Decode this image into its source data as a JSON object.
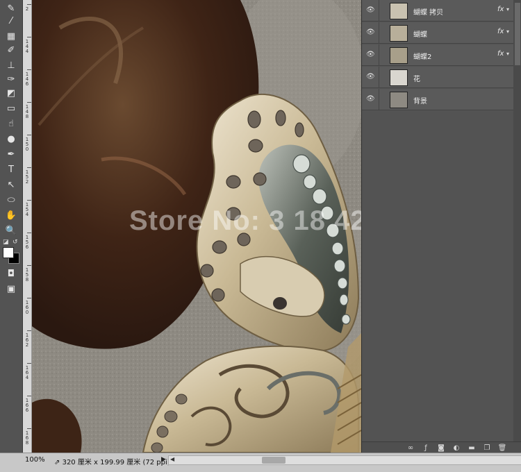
{
  "tools": [
    {
      "icon": "brush-icon",
      "glyph": "✎"
    },
    {
      "icon": "eyedropper-icon",
      "glyph": "⁄"
    },
    {
      "icon": "marquee-grid-icon",
      "glyph": "▦"
    },
    {
      "icon": "brush-tool-icon",
      "glyph": "✐"
    },
    {
      "icon": "stamp-icon",
      "glyph": "⊥"
    },
    {
      "icon": "history-brush-icon",
      "glyph": "✑"
    },
    {
      "icon": "eraser-icon",
      "glyph": "◩"
    },
    {
      "icon": "gradient-icon",
      "glyph": "▭"
    },
    {
      "icon": "smudge-icon",
      "glyph": "☝"
    },
    {
      "icon": "dodge-icon",
      "glyph": "●"
    },
    {
      "icon": "pen-icon",
      "glyph": "✒"
    },
    {
      "icon": "type-icon",
      "glyph": "T"
    },
    {
      "icon": "path-select-icon",
      "glyph": "↖"
    },
    {
      "icon": "ellipse-icon",
      "glyph": "⬭"
    },
    {
      "icon": "hand-icon",
      "glyph": "✋"
    },
    {
      "icon": "zoom-icon",
      "glyph": "🔍"
    },
    {
      "icon": "quick-mask-icon",
      "glyph": "◘"
    },
    {
      "icon": "screen-mode-icon",
      "glyph": "▣"
    }
  ],
  "ruler_labels": [
    "2",
    "1 4 4",
    "1 4 6",
    "1 4 8",
    "1 5 0",
    "1 5 2",
    "1 5 4",
    "1 5 6",
    "1 5 8",
    "1 6 0",
    "1 6 2",
    "1 6 4",
    "1 6 6",
    "1 6 8"
  ],
  "canvas": {
    "watermark": "Store No: 3 18 42"
  },
  "layers": [
    {
      "name": "蝴蝶 拷贝",
      "fx": "fx",
      "thumb_color": "#c9c2b0"
    },
    {
      "name": "蝴蝶",
      "fx": "fx",
      "thumb_color": "#b8af9a"
    },
    {
      "name": "蝴蝶2",
      "fx": "fx",
      "thumb_color": "#a89f8a"
    },
    {
      "name": "花",
      "fx": "",
      "thumb_color": "#d9d6cf"
    },
    {
      "name": "背景",
      "fx": "",
      "thumb_color": "#8e8a82"
    }
  ],
  "status": {
    "zoom": "100%",
    "doc_info": "320 厘米 x 199.99 厘米 (72 ppi)"
  },
  "colors": {
    "foreground": "#ffffff",
    "background": "#000000"
  }
}
